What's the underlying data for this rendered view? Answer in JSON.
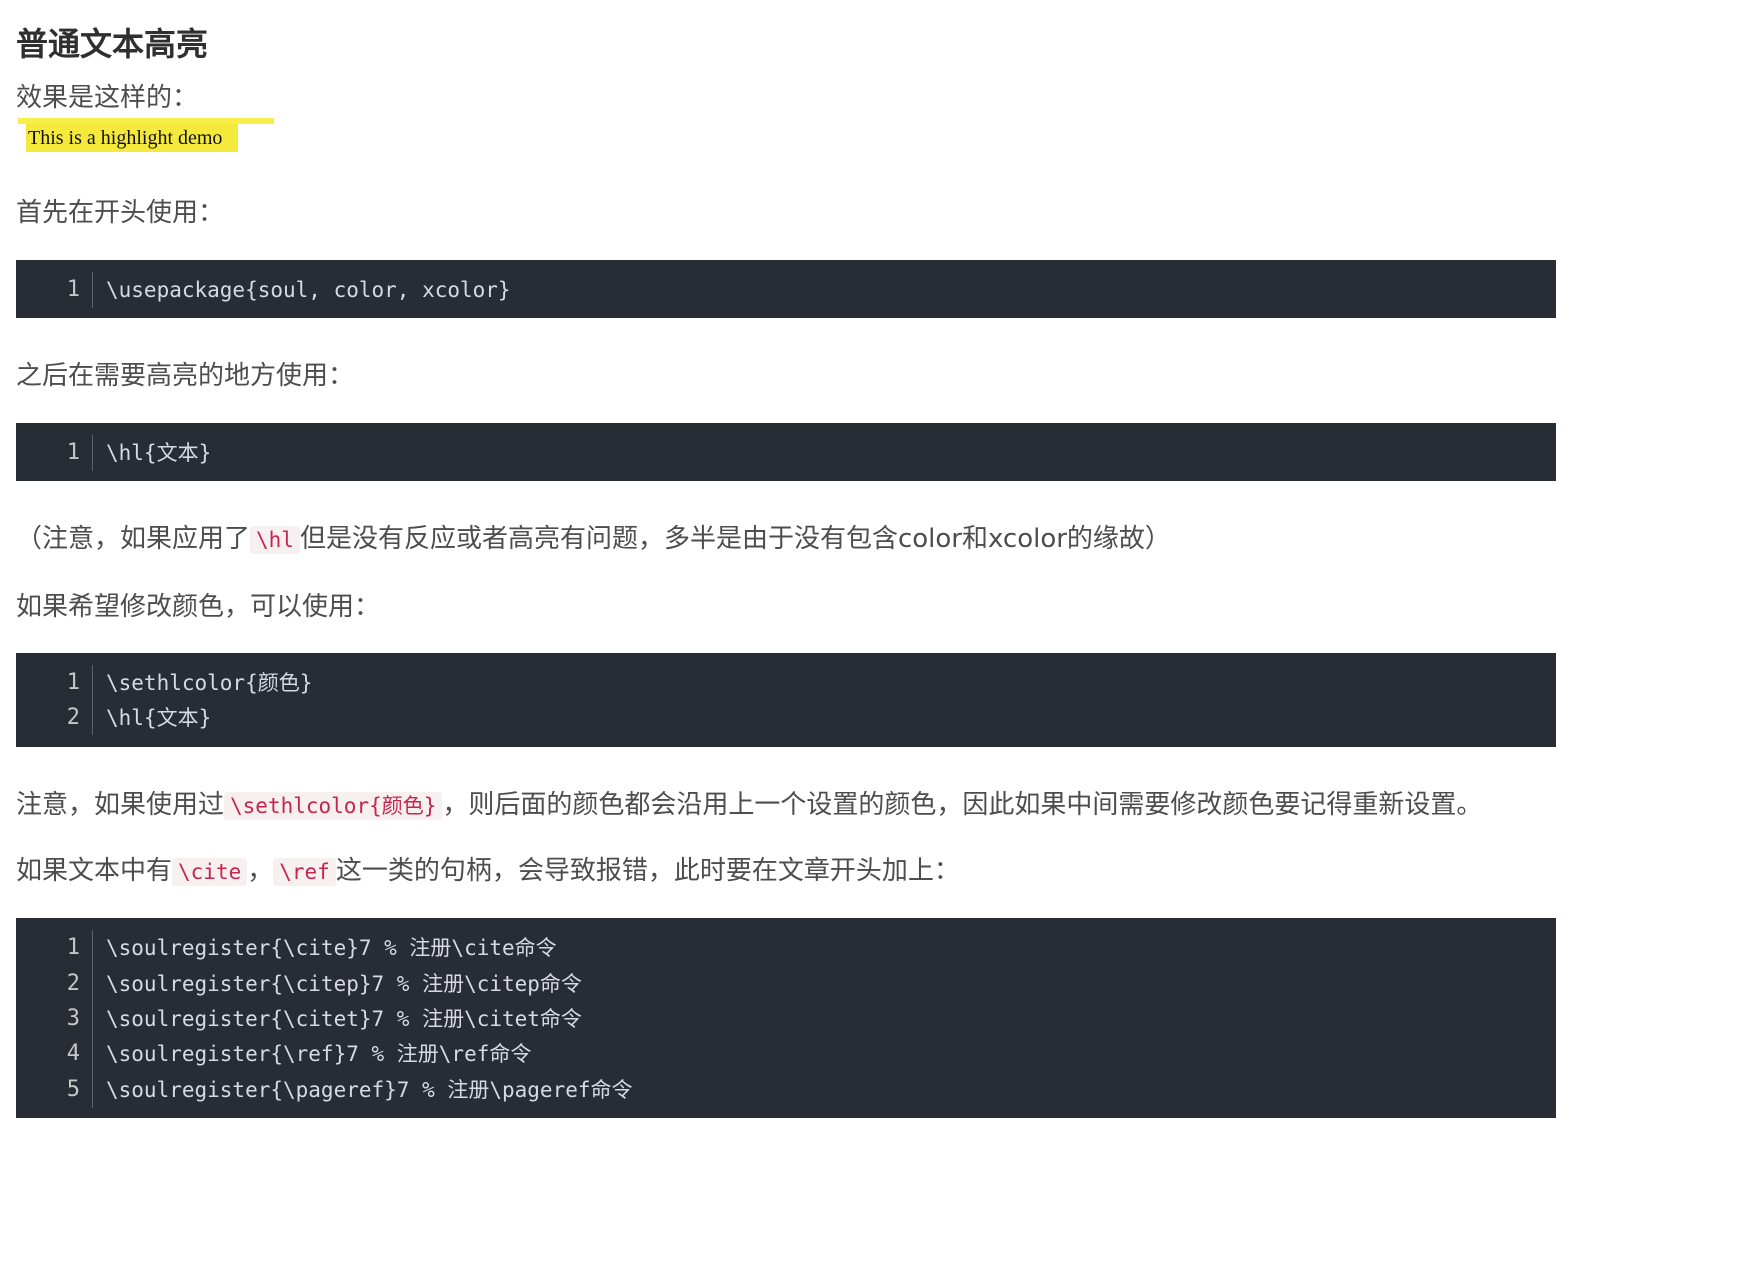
{
  "heading": "普通文本高亮",
  "p_effect": "效果是这样的：",
  "demo_text": "This is a highlight demo",
  "p_first": "首先在开头使用：",
  "code1": [
    {
      "num": "1",
      "text": "\\usepackage{soul, color, xcolor}"
    }
  ],
  "p_then": "之后在需要高亮的地方使用：",
  "code2": [
    {
      "num": "1",
      "text": "\\hl{文本}"
    }
  ],
  "note1": {
    "before": "（注意，如果应用了",
    "code": "\\hl",
    "after": "但是没有反应或者高亮有问题，多半是由于没有包含color和xcolor的缘故）"
  },
  "p_color": "如果希望修改颜色，可以使用：",
  "code3": [
    {
      "num": "1",
      "text": "\\sethlcolor{颜色}"
    },
    {
      "num": "2",
      "text": "\\hl{文本}"
    }
  ],
  "note2": {
    "before": "注意，如果使用过",
    "code": "\\sethlcolor{颜色}",
    "after": "，则后面的颜色都会沿用上一个设置的颜色，因此如果中间需要修改颜色要记得重新设置。"
  },
  "note3": {
    "before": "如果文本中有",
    "code1": "\\cite",
    "sep": "，",
    "code2": "\\ref",
    "after": "这一类的句柄，会导致报错，此时要在文章开头加上："
  },
  "code4": [
    {
      "num": "1",
      "text": "\\soulregister{\\cite}7 % 注册\\cite命令"
    },
    {
      "num": "2",
      "text": "\\soulregister{\\citep}7 % 注册\\citep命令"
    },
    {
      "num": "3",
      "text": "\\soulregister{\\citet}7 % 注册\\citet命令"
    },
    {
      "num": "4",
      "text": "\\soulregister{\\ref}7 % 注册\\ref命令"
    },
    {
      "num": "5",
      "text": "\\soulregister{\\pageref}7 % 注册\\pageref命令"
    }
  ],
  "colors": {
    "code_bg": "#282c34",
    "highlight": "#f5ea3c",
    "inline_code": "#c7254e"
  }
}
